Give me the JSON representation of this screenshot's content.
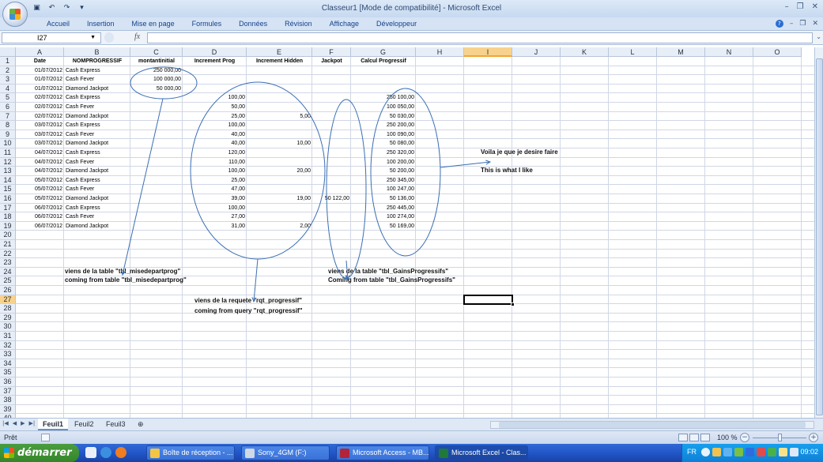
{
  "window": {
    "title": "Classeur1  [Mode de compatibilité] - Microsoft Excel"
  },
  "ribbon": {
    "tabs": [
      "Accueil",
      "Insertion",
      "Mise en page",
      "Formules",
      "Données",
      "Révision",
      "Affichage",
      "Développeur"
    ]
  },
  "formula_bar": {
    "name_box": "I27",
    "fx_label": "fx",
    "value": ""
  },
  "columns": [
    "A",
    "B",
    "C",
    "D",
    "E",
    "F",
    "G",
    "H",
    "I",
    "J",
    "K",
    "L",
    "M",
    "N",
    "O"
  ],
  "selected_column": "I",
  "selected_row": "27",
  "headers": {
    "A": "Date",
    "B": "NOMPROGRESSIF",
    "C": "montantinitial",
    "D": "Increment Prog",
    "E": "Increment Hidden",
    "F": "Jackpot",
    "G": "Calcul Progressif"
  },
  "rows": [
    {
      "date": "01/07/2012",
      "name": "Cash Express",
      "initial": "250 000,00",
      "inc_prog": "",
      "inc_hidden": "",
      "jackpot": "",
      "calc": ""
    },
    {
      "date": "01/07/2012",
      "name": "Cash Fever",
      "initial": "100 000,00",
      "inc_prog": "",
      "inc_hidden": "",
      "jackpot": "",
      "calc": ""
    },
    {
      "date": "01/07/2012",
      "name": "Diamond Jackpot",
      "initial": "50 000,00",
      "inc_prog": "",
      "inc_hidden": "",
      "jackpot": "",
      "calc": ""
    },
    {
      "date": "02/07/2012",
      "name": "Cash Express",
      "initial": "",
      "inc_prog": "100,00",
      "inc_hidden": "",
      "jackpot": "",
      "calc": "250 100,00"
    },
    {
      "date": "02/07/2012",
      "name": "Cash Fever",
      "initial": "",
      "inc_prog": "50,00",
      "inc_hidden": "",
      "jackpot": "",
      "calc": "100 050,00"
    },
    {
      "date": "02/07/2012",
      "name": "Diamond Jackpot",
      "initial": "",
      "inc_prog": "25,00",
      "inc_hidden": "5,00",
      "jackpot": "",
      "calc": "50 030,00"
    },
    {
      "date": "03/07/2012",
      "name": "Cash Express",
      "initial": "",
      "inc_prog": "100,00",
      "inc_hidden": "",
      "jackpot": "",
      "calc": "250 200,00"
    },
    {
      "date": "03/07/2012",
      "name": "Cash Fever",
      "initial": "",
      "inc_prog": "40,00",
      "inc_hidden": "",
      "jackpot": "",
      "calc": "100 090,00"
    },
    {
      "date": "03/07/2012",
      "name": "Diamond Jackpot",
      "initial": "",
      "inc_prog": "40,00",
      "inc_hidden": "10,00",
      "jackpot": "",
      "calc": "50 080,00"
    },
    {
      "date": "04/07/2012",
      "name": "Cash Express",
      "initial": "",
      "inc_prog": "120,00",
      "inc_hidden": "",
      "jackpot": "",
      "calc": "250 320,00"
    },
    {
      "date": "04/07/2012",
      "name": "Cash Fever",
      "initial": "",
      "inc_prog": "110,00",
      "inc_hidden": "",
      "jackpot": "",
      "calc": "100 200,00"
    },
    {
      "date": "04/07/2012",
      "name": "Diamond Jackpot",
      "initial": "",
      "inc_prog": "100,00",
      "inc_hidden": "20,00",
      "jackpot": "",
      "calc": "50 200,00"
    },
    {
      "date": "05/07/2012",
      "name": "Cash Express",
      "initial": "",
      "inc_prog": "25,00",
      "inc_hidden": "",
      "jackpot": "",
      "calc": "250 345,00"
    },
    {
      "date": "05/07/2012",
      "name": "Cash Fever",
      "initial": "",
      "inc_prog": "47,00",
      "inc_hidden": "",
      "jackpot": "",
      "calc": "100 247,00"
    },
    {
      "date": "05/07/2012",
      "name": "Diamond Jackpot",
      "initial": "",
      "inc_prog": "39,00",
      "inc_hidden": "19,00",
      "jackpot": "50 122,00",
      "calc": "50 136,00"
    },
    {
      "date": "06/07/2012",
      "name": "Cash Express",
      "initial": "",
      "inc_prog": "100,00",
      "inc_hidden": "",
      "jackpot": "",
      "calc": "250 445,00"
    },
    {
      "date": "06/07/2012",
      "name": "Cash Fever",
      "initial": "",
      "inc_prog": "27,00",
      "inc_hidden": "",
      "jackpot": "",
      "calc": "100 274,00"
    },
    {
      "date": "06/07/2012",
      "name": "Diamond Jackpot",
      "initial": "",
      "inc_prog": "31,00",
      "inc_hidden": "2,00",
      "jackpot": "",
      "calc": "50 169,00"
    }
  ],
  "annotations": {
    "desire_fr": "Voila je que je desire faire",
    "desire_en": "This is what I like",
    "misedepart_fr": "viens de la table \"tbl_misedepartprog\"",
    "misedepart_en": "coming from table \"tbl_misedepartprog\"",
    "gains_fr": "viens de la table \"tbl_GainsProgressifs\"",
    "gains_en": "Coming from table \"tbl_GainsProgressifs\"",
    "requete_fr": "viens de la requete \"rqt_progressif\"",
    "requete_en": "coming from query \"rqt_progressif\""
  },
  "sheet_tabs": [
    "Feuil1",
    "Feuil2",
    "Feuil3"
  ],
  "status": {
    "text": "Prêt",
    "zoom": "100 %"
  },
  "taskbar": {
    "start_label": "démarrer",
    "tasks": [
      "Boîte de réception - ...",
      "Sony_4GM (F:)",
      "Microsoft Access - MB...",
      "Microsoft Excel - Clas..."
    ],
    "lang": "FR",
    "clock": "09:02"
  },
  "colors": {
    "accent_selected": "#f8d28d",
    "annotation_line": "#3b6fb3",
    "taskbar": "#2157c7",
    "start": "#35862b"
  }
}
